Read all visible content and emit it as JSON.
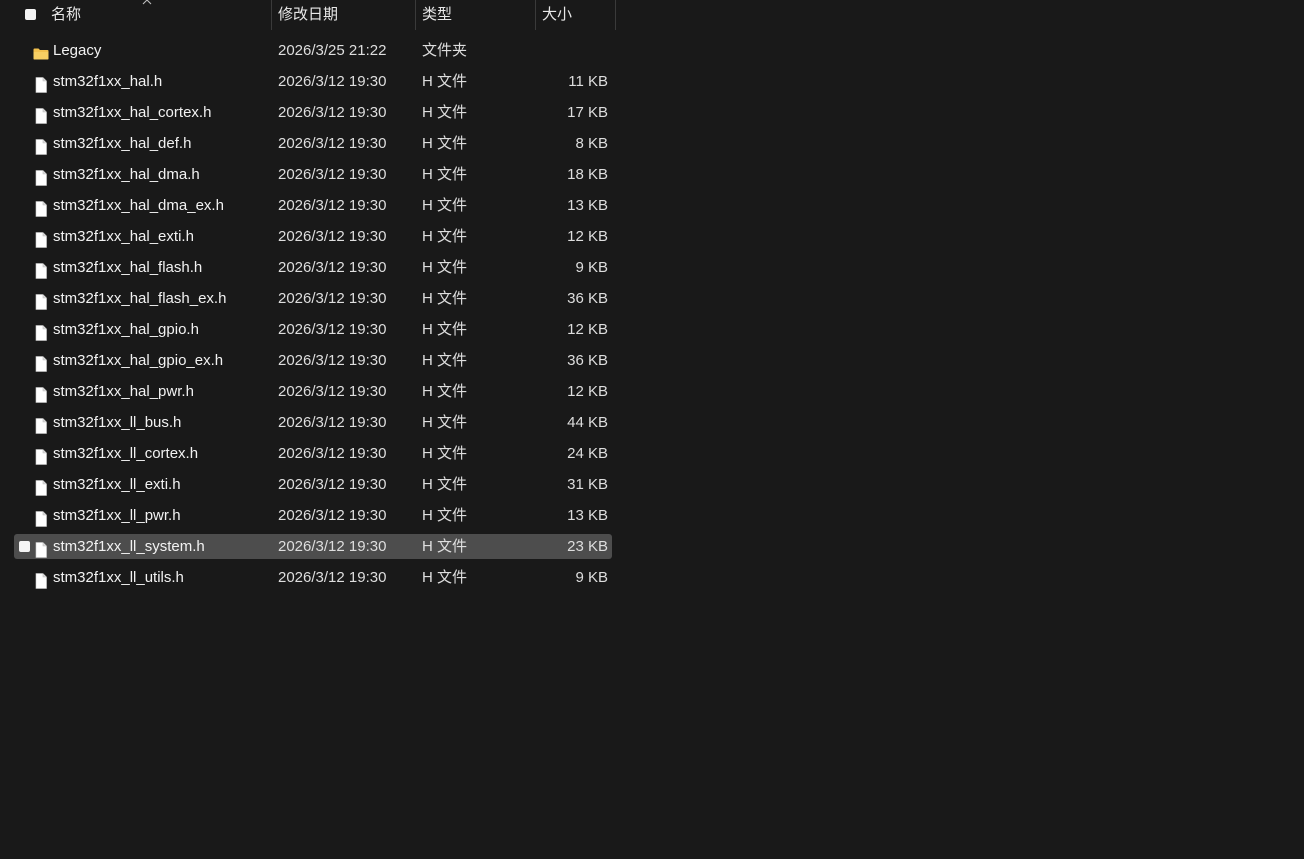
{
  "header": {
    "name": "名称",
    "date": "修改日期",
    "type": "类型",
    "size": "大小"
  },
  "files": [
    {
      "name": "Legacy",
      "date": "2026/3/25 21:22",
      "type": "文件夹",
      "size": "",
      "icon": "folder-icon"
    },
    {
      "name": "stm32f1xx_hal.h",
      "date": "2026/3/12 19:30",
      "type": "H 文件",
      "size": "11 KB",
      "icon": "file-icon"
    },
    {
      "name": "stm32f1xx_hal_cortex.h",
      "date": "2026/3/12 19:30",
      "type": "H 文件",
      "size": "17 KB",
      "icon": "file-icon"
    },
    {
      "name": "stm32f1xx_hal_def.h",
      "date": "2026/3/12 19:30",
      "type": "H 文件",
      "size": "8 KB",
      "icon": "file-icon"
    },
    {
      "name": "stm32f1xx_hal_dma.h",
      "date": "2026/3/12 19:30",
      "type": "H 文件",
      "size": "18 KB",
      "icon": "file-icon"
    },
    {
      "name": "stm32f1xx_hal_dma_ex.h",
      "date": "2026/3/12 19:30",
      "type": "H 文件",
      "size": "13 KB",
      "icon": "file-icon"
    },
    {
      "name": "stm32f1xx_hal_exti.h",
      "date": "2026/3/12 19:30",
      "type": "H 文件",
      "size": "12 KB",
      "icon": "file-icon"
    },
    {
      "name": "stm32f1xx_hal_flash.h",
      "date": "2026/3/12 19:30",
      "type": "H 文件",
      "size": "9 KB",
      "icon": "file-icon"
    },
    {
      "name": "stm32f1xx_hal_flash_ex.h",
      "date": "2026/3/12 19:30",
      "type": "H 文件",
      "size": "36 KB",
      "icon": "file-icon"
    },
    {
      "name": "stm32f1xx_hal_gpio.h",
      "date": "2026/3/12 19:30",
      "type": "H 文件",
      "size": "12 KB",
      "icon": "file-icon"
    },
    {
      "name": "stm32f1xx_hal_gpio_ex.h",
      "date": "2026/3/12 19:30",
      "type": "H 文件",
      "size": "36 KB",
      "icon": "file-icon"
    },
    {
      "name": "stm32f1xx_hal_pwr.h",
      "date": "2026/3/12 19:30",
      "type": "H 文件",
      "size": "12 KB",
      "icon": "file-icon"
    },
    {
      "name": "stm32f1xx_ll_bus.h",
      "date": "2026/3/12 19:30",
      "type": "H 文件",
      "size": "44 KB",
      "icon": "file-icon"
    },
    {
      "name": "stm32f1xx_ll_cortex.h",
      "date": "2026/3/12 19:30",
      "type": "H 文件",
      "size": "24 KB",
      "icon": "file-icon"
    },
    {
      "name": "stm32f1xx_ll_exti.h",
      "date": "2026/3/12 19:30",
      "type": "H 文件",
      "size": "31 KB",
      "icon": "file-icon"
    },
    {
      "name": "stm32f1xx_ll_pwr.h",
      "date": "2026/3/12 19:30",
      "type": "H 文件",
      "size": "13 KB",
      "icon": "file-icon"
    },
    {
      "name": "stm32f1xx_ll_system.h",
      "date": "2026/3/12 19:30",
      "type": "H 文件",
      "size": "23 KB",
      "icon": "file-icon",
      "selected": true
    },
    {
      "name": "stm32f1xx_ll_utils.h",
      "date": "2026/3/12 19:30",
      "type": "H 文件",
      "size": "9 KB",
      "icon": "file-icon"
    }
  ],
  "colors": {
    "background": "#191919",
    "selected_row": "#4d4d4d",
    "folder": "#f2c14e",
    "file": "#ffffff"
  }
}
